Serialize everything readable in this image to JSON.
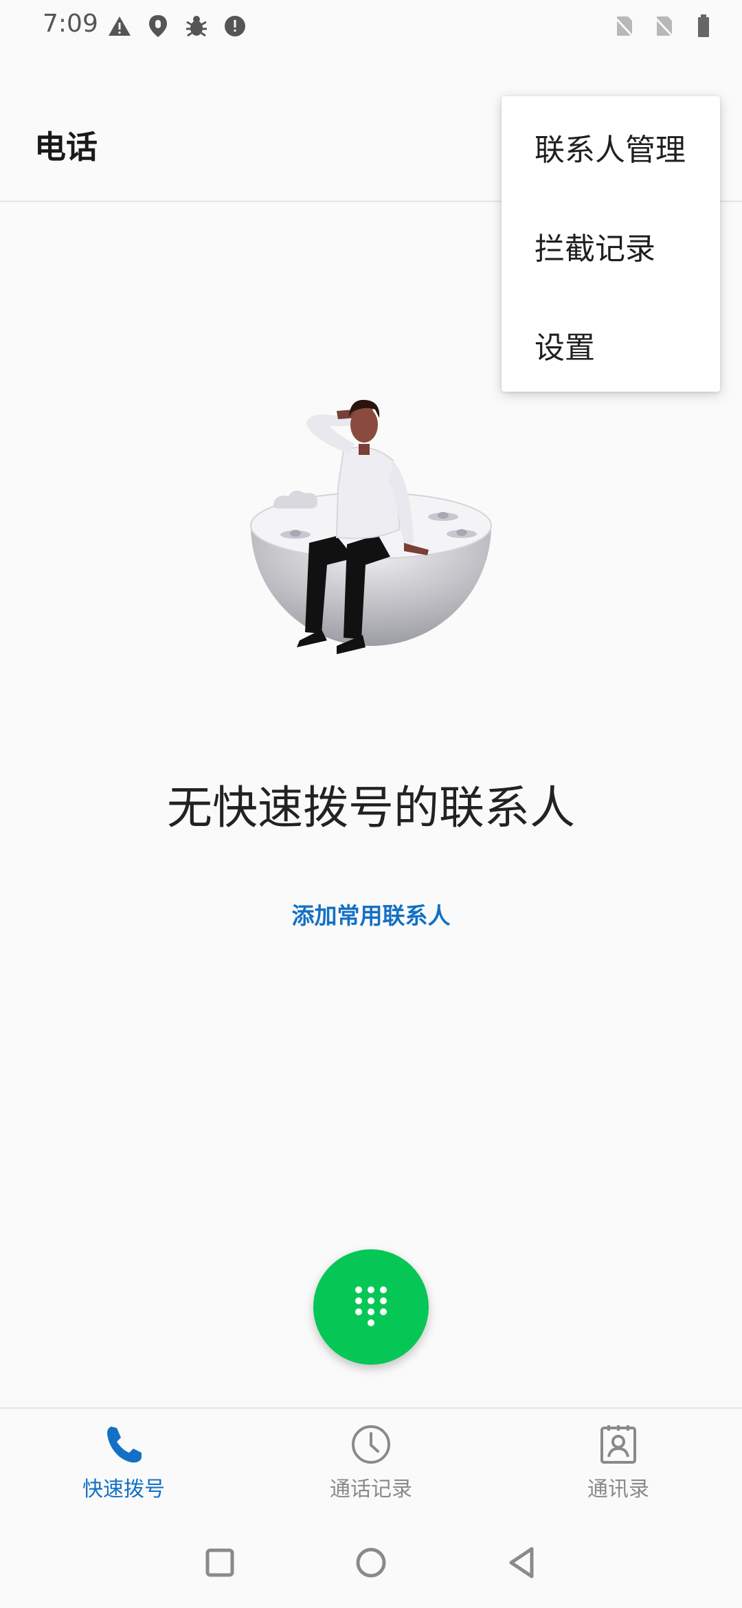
{
  "status_bar": {
    "time": "7:09",
    "left_icons": [
      "warning-icon",
      "location-shield-icon",
      "bug-icon",
      "alert-icon"
    ],
    "right_icons": [
      "no-sim-icon",
      "no-sim-icon",
      "battery-icon"
    ]
  },
  "app_bar": {
    "title": "电话"
  },
  "overflow_menu": {
    "items": [
      "联系人管理",
      "拦截记录",
      "设置"
    ]
  },
  "empty_state": {
    "illustration": "person-sitting-on-hemisphere-illustration",
    "title": "无快速拨号的联系人",
    "action": "添加常用联系人"
  },
  "fab": {
    "icon": "dialpad-icon",
    "color": "#06c755"
  },
  "bottom_nav": {
    "items": [
      {
        "label": "快速拨号",
        "icon": "phone-icon",
        "active": true
      },
      {
        "label": "通话记录",
        "icon": "clock-icon",
        "active": false
      },
      {
        "label": "通讯录",
        "icon": "contacts-icon",
        "active": false
      }
    ]
  },
  "colors": {
    "accent": "#1470c4",
    "fab": "#06c755",
    "background": "#fafafa"
  }
}
